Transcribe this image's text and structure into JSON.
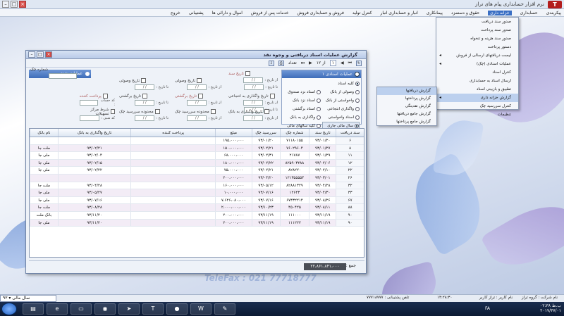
{
  "app": {
    "title": "نرم افزار حسابداری پیام های تراز",
    "logo": "T"
  },
  "menubar": [
    "پیکربندی",
    "حسابداری",
    "خزانه داری",
    "حقوق و دستمزد",
    "پیمانکاری",
    "انبار و حسابداری انبار",
    "کنترل تولید",
    "فروش و حسابداری فروش",
    "خدمات پس از فروش",
    "اموال و دارائی ها",
    "پشتیبانی",
    "خروج"
  ],
  "menu_treasury": {
    "items": [
      "صدور سند دریافت",
      "صدور سند پرداخت",
      "صدور سند هزینه و تنخواه",
      "دستور پرداخت",
      "لیست دریافتهای ارسالی از فروش",
      "عملیات اسنادی (چک)",
      "کنترل اسناد",
      "ارسال اسناد به حسابداری",
      "تطبیق و بازبینی اسناد",
      "گزارش خزانه داری",
      "کنترل سررسید چک",
      "تنظیمات"
    ],
    "selected": "گزارش خزانه داری"
  },
  "submenu_report": {
    "items": [
      "گزارش دریافتها",
      "گزارش پرداختها",
      "گزارش نقدینگی",
      "گزارش جامع دریافتها",
      "گزارش جامع پرداختها"
    ],
    "selected": "گزارش دریافتها"
  },
  "report_window": {
    "title": "گزارش عملیات اسناد دریافتی و وجوه نقد",
    "toolbar": {
      "pager": "از ۱۲",
      "page": "۱",
      "nav_label": "تعداد"
    },
    "doc_ops": {
      "title": "عملیات اسنادی ۱",
      "options": [
        "کلیه اسناد",
        "وصولی از بانک",
        "اسناد نزد صندوق",
        "واخواستی از بانک",
        "اسناد نزد بانک",
        "واگذاری انتجاعی",
        "اسناد برگشتی",
        "اسناد واخواستی",
        "واگذاری به بانک",
        "سال مالی جاری",
        "کلیه سالهای مالی"
      ],
      "selected": "کلیه اسناد"
    },
    "cash_ops": "عملیات نقدی",
    "filters": {
      "receipt_date": "تاریخ وصولی",
      "issue_date": "تاریخ سند",
      "return_date": "تاریخ برگشتی",
      "assign_date": "تاریخ واگذاری به انتجاعی",
      "due_range": "محدوده سررسید چک",
      "bank_assign_date": "تاریخ واگذاری به بانک",
      "payer": "پرداخت کننده",
      "center": "شرط مرکز تسهیلات",
      "payer_code": "کد حساب :",
      "center_code": "کد شبی :",
      "check_no": "شماره چک",
      "from": "از تاریخ :",
      "to": "تا تاریخ :",
      "date_mask": "/ /"
    },
    "table": {
      "columns": [
        "سند دریافت",
        "تاریخ سند",
        "شماره چک",
        "سررسید چک",
        "مبلغ",
        "پرداخت کننده",
        "تاریخ واگذاری به بانک",
        "نام بانک"
      ],
      "rows": [
        [
          "۶",
          "۹۳/۰۱/۲۰",
          "۷۱۱۸۰۱۵۵",
          "۹۳/۰۱/۲۰",
          "۱۹۵،۰۰۰،۰۰۰",
          "",
          "",
          ""
        ],
        [
          "۸",
          "۹۳/۰۱/۲۷",
          "۷۶۰۲۹۶۰۴",
          "۹۳/۰۲/۲۱",
          "۱۵۰،۰۰۰،۰۰۰",
          "",
          "۹۳/۰۲/۲۱",
          "ملت جا"
        ],
        [
          "۱۱",
          "۹۳/۰۱/۲۹",
          "۲۱۷۸۷",
          "۹۳/۰۲/۳۱",
          "۶۸،۰۰۰،۰۰۰",
          "",
          "۹۳/۰۲/۰۴",
          "ملی جا"
        ],
        [
          "۱۲",
          "۹۳/۰۲/۰۶",
          "۸۲۵۹۰۳۲۸۸",
          "۹۳/۰۲/۲۲",
          "۱۸۰،۰۰۰،۰۰۰",
          "",
          "۹۳/۰۲/۱۵",
          "ملی جا"
        ],
        [
          "۲۲",
          "۹۳/۰۲/۱۰",
          "۸۲۸۲۲۰",
          "۹۳/۰۲/۲۱",
          "۷۵،۰۰۰،۰۰۰",
          "",
          "۹۳/۰۲/۲۲",
          "ملی جا"
        ],
        [
          "۲۶",
          "۹۳/۰۳/۰۱",
          "۱۲۱۳۵۵۵۵۴",
          "۹۳/۰۴/۲۰",
          "۲۰۰،۰۰۰،۰۰۰",
          "",
          "",
          ""
        ],
        [
          "۳۲",
          "۹۳/۰۴/۲۸",
          "۸۲۸۸۱۳۲۹",
          "۹۳/۰۵/۱۲",
          "۱۶۰،۰۰۰،۰۰۰",
          "",
          "۹۳/۰۴/۲۸",
          "ملت جا"
        ],
        [
          "۳۳",
          "۹۳/۰۴/۳۰",
          "۱۲۶۴۳",
          "۹۳/۰۷/۱۶",
          "۱۰،۰۰۰،۰۰۰",
          "",
          "۹۳/۰۵/۲۷",
          "ملی جا"
        ],
        [
          "۶۷",
          "۹۳/۰۸/۲۶",
          "۶۷۴۳۲۲۱۴",
          "۹۳/۰۷/۱۶",
          "۷،۶۲۶،۰۸۰،۰۰۰",
          "",
          "۹۳/۰۷/۱۶",
          "ملی جا"
        ],
        [
          "۸۸",
          "۹۳/۰۸/۱۱",
          "۴۵۰۴۲۵",
          "۹۳/۱۰/۲۳",
          "۲،۰۰۰،۰۰۰،۰۰۰",
          "",
          "۹۳/۰۸/۲۸",
          "ملت جا"
        ],
        [
          "۹۰",
          "۹۳/۱۱/۱۹",
          "۱۱۱۰۰۰",
          "۹۳/۱۱/۱۹",
          "۲۰۰،۰۰۰،۰۰۰",
          "",
          "۹۳/۱۱/۲۰",
          "بانک ملت"
        ],
        [
          "۹۰",
          "۹۳/۱۱/۱۹",
          "۱۱۱۲۲۲",
          "۹۳/۱۱/۱۹",
          "۲۰۰،۰۰۰،۰۰۰",
          "",
          "۹۳/۱۱/۲۰",
          "ملی جا"
        ]
      ]
    },
    "total_label": "جمع :",
    "total_value": "۲۲،۸۶۱،۸۴۱،۰۰۰"
  },
  "watermark": "TeleFax : 021 77718777",
  "statusbar": {
    "year_label": "سال مالی",
    "year_value": "۹۳",
    "support": "تلفن پشتیبانی : ۷۷۷۱۸۷۷۷",
    "time": "۱۴:۲۸:۳۰",
    "user": "نام کاربر : تراز کاربر",
    "company": "نام شرکت : گروه تراز"
  },
  "taskbar": {
    "lang": "FA",
    "time": "۰۲:۳۸ ب.ظ",
    "date": "۲۰۱۷/۳۷/۰۱"
  }
}
